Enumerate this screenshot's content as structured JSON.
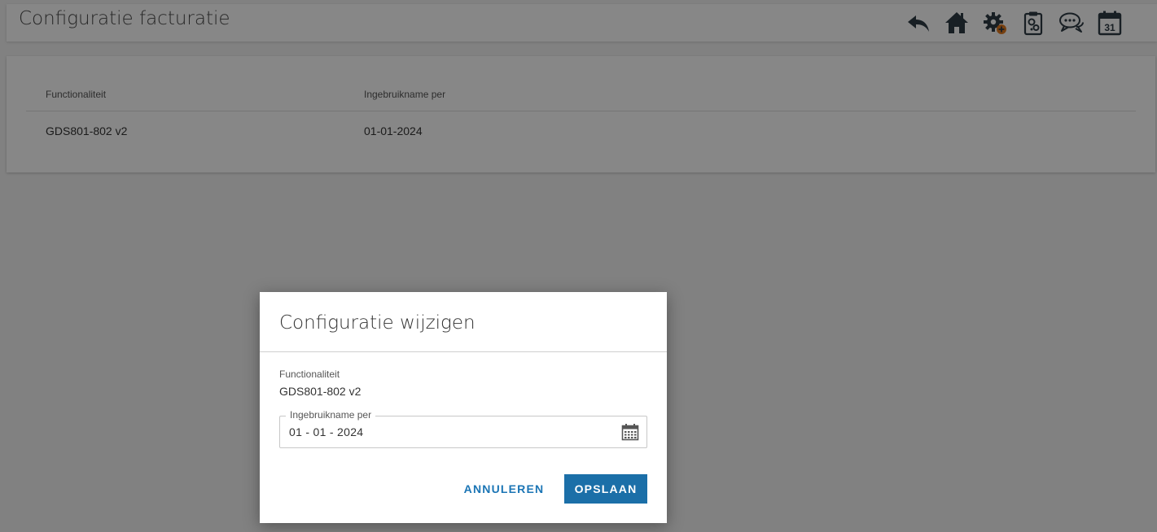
{
  "header": {
    "title": "Configuratie facturatie",
    "icons": [
      "reply-icon",
      "home-icon",
      "gear-add-icon",
      "clipboard-settings-icon",
      "chat-icon",
      "calendar-31-icon"
    ],
    "calendar_day": "31"
  },
  "table": {
    "columns": [
      "Functionaliteit",
      "Ingebruikname per"
    ],
    "rows": [
      [
        "GDS801-802 v2",
        "01-01-2024"
      ]
    ]
  },
  "dialog": {
    "title": "Configuratie wijzigen",
    "field_label": "Functionaliteit",
    "field_value": "GDS801-802 v2",
    "date_label": "Ingebruikname per",
    "date_value": "01 - 01 - 2024",
    "cancel_label": "ANNULEREN",
    "save_label": "OPSLAAN"
  },
  "colors": {
    "accent": "#1b6fa8",
    "link": "#1b75b5",
    "gear_badge": "#e07a1f",
    "icon": "#2f3b45"
  }
}
